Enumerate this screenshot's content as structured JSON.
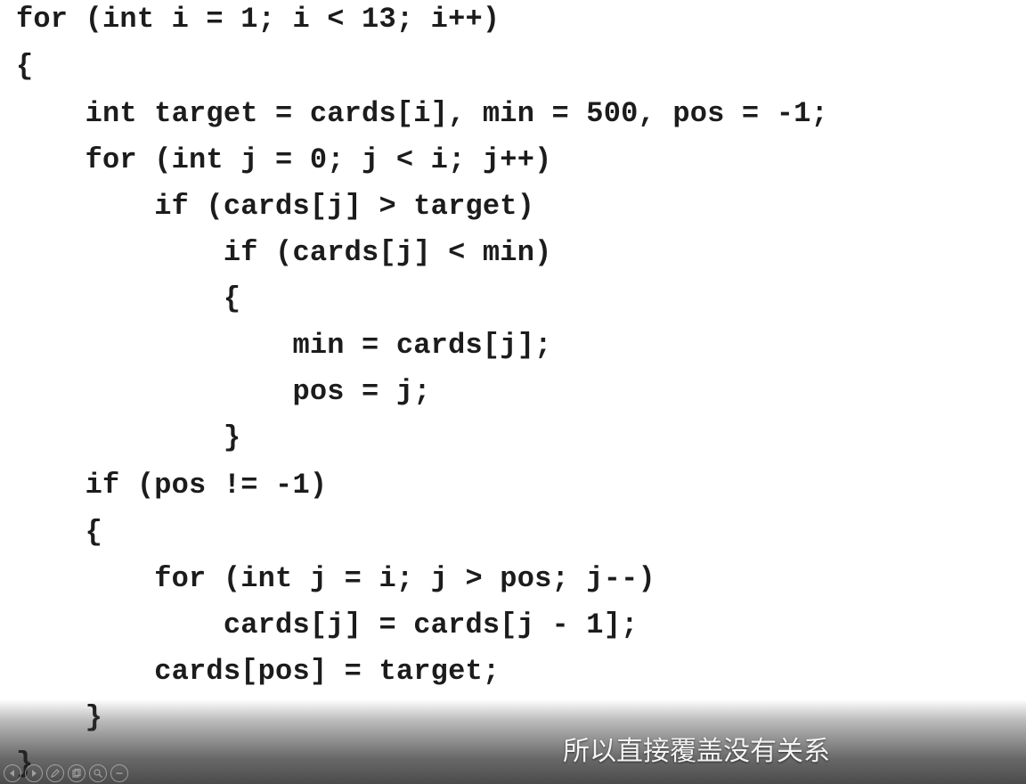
{
  "code_lines": [
    "for (int i = 1; i < 13; i++)",
    "{",
    "    int target = cards[i], min = 500, pos = -1;",
    "    for (int j = 0; j < i; j++)",
    "        if (cards[j] > target)",
    "            if (cards[j] < min)",
    "            {",
    "                min = cards[j];",
    "                pos = j;",
    "            }",
    "    if (pos != -1)",
    "    {",
    "        for (int j = i; j > pos; j--)",
    "            cards[j] = cards[j - 1];",
    "        cards[pos] = target;",
    "    }",
    "}"
  ],
  "subtitle": "所以直接覆盖没有关系",
  "player_controls": [
    "prev-icon",
    "next-icon",
    "pen-icon",
    "copy-icon",
    "zoom-icon",
    "minus-icon"
  ]
}
